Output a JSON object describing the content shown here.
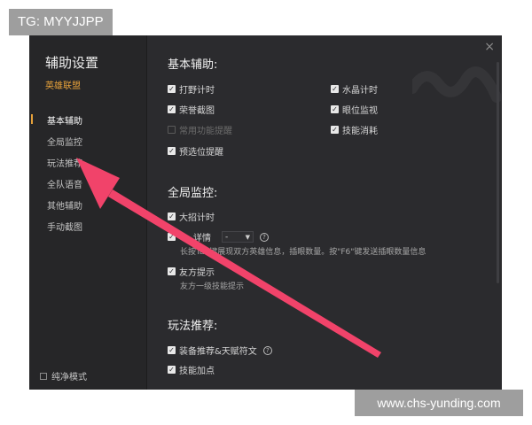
{
  "watermarks": {
    "top_left": "TG: MYYJJPP",
    "bottom_right": "www.chs-yunding.com"
  },
  "sidebar": {
    "title": "辅助设置",
    "game": "英雄联盟",
    "items": [
      {
        "label": "基本辅助",
        "active": true
      },
      {
        "label": "全局监控",
        "active": false
      },
      {
        "label": "玩法推荐",
        "active": false
      },
      {
        "label": "全队语音",
        "active": false
      },
      {
        "label": "其他辅助",
        "active": false
      },
      {
        "label": "手动截图",
        "active": false
      }
    ],
    "pure_mode": "纯净模式"
  },
  "window": {
    "close_icon": "×"
  },
  "sections": {
    "basic": {
      "title": "基本辅助:",
      "options": [
        {
          "label": "打野计时",
          "checked": true
        },
        {
          "label": "水晶计时",
          "checked": true
        },
        {
          "label": "荣誉截图",
          "checked": true
        },
        {
          "label": "眼位监视",
          "checked": true
        },
        {
          "label": "常用功能提醒",
          "checked": false
        },
        {
          "label": "技能消耗",
          "checked": true
        },
        {
          "label": "预选位提醒",
          "checked": true
        }
      ]
    },
    "monitor": {
      "title": "全局监控:",
      "ult_timer": "大招计时",
      "detail_label": "详情",
      "detail_value": "-",
      "detail_desc": "长按Tab键展现双方英雄信息，插眼数量。按\"F6\"键发送插眼数量信息",
      "ally_tip": "友方提示",
      "ally_desc": "友方一级技能提示"
    },
    "play": {
      "title": "玩法推荐:",
      "equip": "装备推荐&天赋符文",
      "skill": "技能加点"
    }
  },
  "colors": {
    "accent": "#e6a13a",
    "arrow": "#f1436a"
  }
}
